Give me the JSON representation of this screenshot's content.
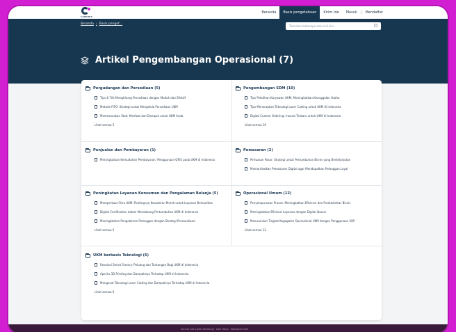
{
  "header": {
    "logo_text": "CAWIDEA",
    "nav": [
      "Beranda",
      "Basis pengetahuan",
      "Kirim Ide",
      "Masuk",
      "Mendaftar"
    ]
  },
  "breadcrumb": [
    "Beranda",
    "Basis penget..."
  ],
  "search": {
    "placeholder": "Temukan beberapa solusi di sini..."
  },
  "page_title": "Artikel Pengembangan Operasional (7)",
  "sections": [
    {
      "title": "Pergudangan dan Persediaan (5)",
      "articles": [
        "Tips & Trik Menghitung Persediaan dengan Mudah dan Efektif",
        "Metode FIFO: Strategi untuk Mengelola Persediaan UKM",
        "Memesanakan Stok: Manfaat dan Dampak untuk UKM Anda"
      ],
      "see_all": "Lihat semua 5"
    },
    {
      "title": "Pengembangan SDM (10)",
      "articles": [
        "Tips Pelatihan Karyawan UKM: Meningkatkan Keunggulan Usaha",
        "Tips Menerapkan Teknologi Laser Cutting untuk UKM di Indonesia",
        "Digital Custom Ordering: Inovasi Terbaru untuk UKM di Indonesia"
      ],
      "see_all": "Lihat semua 10"
    },
    {
      "title": "Penjualan dan Pembayaran (1)",
      "articles": [
        "Meningkatkan Kemudahan Pembayaran: Penggunaan QRIS pada UKM di Indonesia"
      ],
      "see_all": ""
    },
    {
      "title": "Pemasaran (2)",
      "articles": [
        "Perluasan Pasar: Strategi untuk Pertumbuhan Bisnis yang Berkelanjutan",
        "Memanfaatkan Pemasaran Digital agar Mendapatkan Pelanggan Loyal"
      ],
      "see_all": ""
    },
    {
      "title": "Peningkatan Layanan Konsumen dan Pengalaman Belanja (5)",
      "articles": [
        "Memperkuat Citra UKM: Pentingnya Kesadaran Merek untuk Layanan Berkualitas",
        "Digital Certification dalam Mendukung Pertumbuhan UKM di Indonesia",
        "Meningkatkan Pengalaman Pelanggan dengan Strategi Personalisasi"
      ],
      "see_all": "Lihat semua 5"
    },
    {
      "title": "Operasional Umum (12)",
      "articles": [
        "Penyempurnaan Proses: Meningkatkan Efisiensi dan Produktivitas Bisnis",
        "Meningkatkan Efisiensi Layanan dengan Digital Queue",
        "Menurunkan Tingkat Kegagalan Operasional UKM dengan Penggunaan SOP"
      ],
      "see_all": "Lihat semua 12"
    },
    {
      "title": "UKM berbasis Teknologi (6)",
      "articles": [
        "Revolusi Smart Factory: Peluang dan Tantangan Bagi UKM di Indonesia",
        "Apa itu 3D Printing dan Dampaknya Terhadap UKM di Indonesia",
        "Mengenal Teknologi Laser Cutting dan Dampaknya Terhadap UKM di Indonesia"
      ],
      "see_all": "Lihat semua 6"
    }
  ],
  "footer": {
    "text": "Semua hak cipta dilindungi · Dari Odoo · Kebijakan kuki"
  },
  "colors": {
    "navy": "#17364f",
    "magenta": "#d21fd2",
    "card": "#ffffff",
    "page_bg": "#f3f4f6"
  }
}
